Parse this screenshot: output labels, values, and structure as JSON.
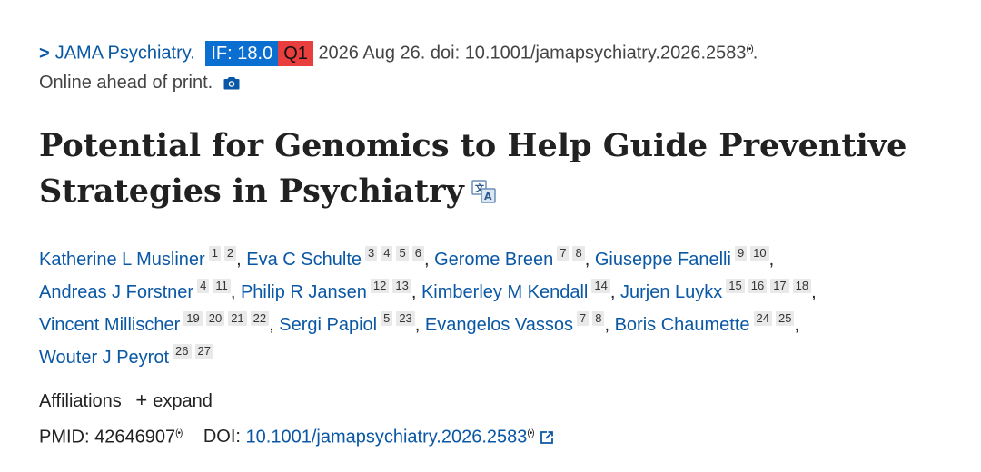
{
  "citation": {
    "chevron": ">",
    "journal": "JAMA Psychiatry.",
    "impact_factor": "IF: 18.0",
    "quartile": "Q1",
    "date_doi": "2026 Aug 26. doi: 10.1001/jamapsychiatry.2026.2583",
    "radio_mark": "(•)",
    "trailing_period": ".",
    "status": "Online ahead of print."
  },
  "article": {
    "title": "Potential for Genomics to Help Guide Preventive Strategies in Psychiatry"
  },
  "authors": [
    {
      "name": "Katherine L Musliner",
      "affs": [
        "1",
        "2"
      ]
    },
    {
      "name": "Eva C Schulte",
      "affs": [
        "3",
        "4",
        "5",
        "6"
      ]
    },
    {
      "name": "Gerome Breen",
      "affs": [
        "7",
        "8"
      ]
    },
    {
      "name": "Giuseppe Fanelli",
      "affs": [
        "9",
        "10"
      ]
    },
    {
      "name": "Andreas J Forstner",
      "affs": [
        "4",
        "11"
      ]
    },
    {
      "name": "Philip R Jansen",
      "affs": [
        "12",
        "13"
      ]
    },
    {
      "name": "Kimberley M Kendall",
      "affs": [
        "14"
      ]
    },
    {
      "name": "Jurjen Luykx",
      "affs": [
        "15",
        "16",
        "17",
        "18"
      ]
    },
    {
      "name": "Vincent Millischer",
      "affs": [
        "19",
        "20",
        "21",
        "22"
      ]
    },
    {
      "name": "Sergi Papiol",
      "affs": [
        "5",
        "23"
      ]
    },
    {
      "name": "Evangelos Vassos",
      "affs": [
        "7",
        "8"
      ]
    },
    {
      "name": "Boris Chaumette",
      "affs": [
        "24",
        "25"
      ]
    },
    {
      "name": "Wouter J Peyrot",
      "affs": [
        "26",
        "27"
      ]
    }
  ],
  "affiliations": {
    "label": "Affiliations",
    "plus": "+",
    "expand_label": "expand"
  },
  "identifiers": {
    "pmid_label": "PMID:",
    "pmid": "42646907",
    "doi_label": "DOI:",
    "doi": "10.1001/jamapsychiatry.2026.2583",
    "radio_mark": "(•)"
  }
}
